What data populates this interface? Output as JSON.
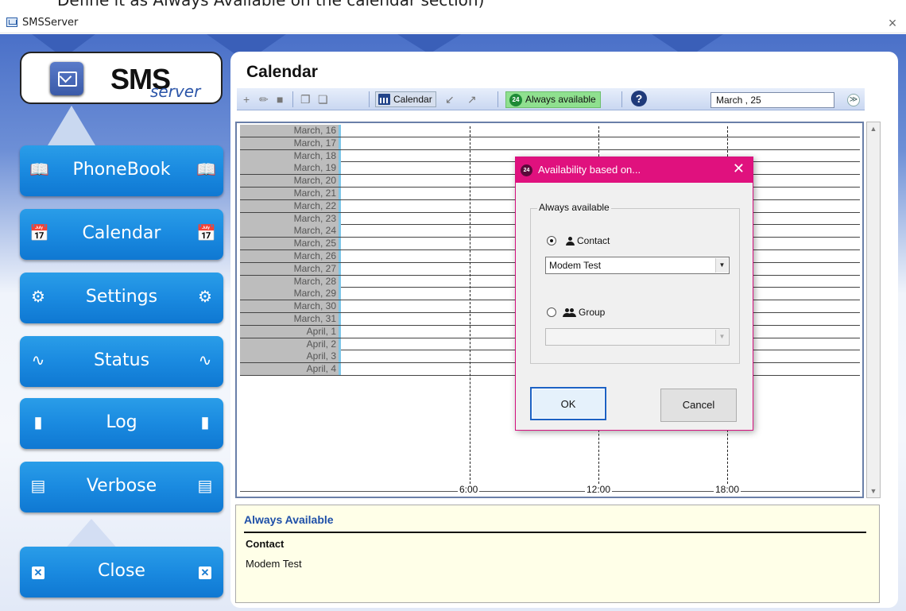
{
  "top_strip": {
    "text": "Define it as Always Available on the calendar section)"
  },
  "window": {
    "title": "SMSServer",
    "close_glyph": "×"
  },
  "logo": {
    "sms": "SMS",
    "server": "server"
  },
  "nav": [
    {
      "label": "PhoneBook",
      "icon": "book-icon"
    },
    {
      "label": "Calendar",
      "icon": "calendar-clock-icon"
    },
    {
      "label": "Settings",
      "icon": "gears-icon"
    },
    {
      "label": "Status",
      "icon": "pulse-icon"
    },
    {
      "label": "Log",
      "icon": "chat-icon"
    },
    {
      "label": "Verbose",
      "icon": "cards-icon"
    },
    {
      "label": "Close",
      "icon": "close-box-icon"
    }
  ],
  "calendar": {
    "title": "Calendar",
    "toolbar": {
      "calendar_label": "Calendar",
      "always_available_label": "Always available",
      "date_value": "March , 25",
      "help_glyph": "?",
      "expand_glyph": "≫"
    },
    "rows": [
      "March, 16",
      "March, 17",
      "March, 18",
      "March, 19",
      "March, 20",
      "March, 21",
      "March, 22",
      "March, 23",
      "March, 24",
      "March, 25",
      "March, 26",
      "March, 27",
      "March, 28",
      "March, 29",
      "March, 30",
      "March, 31",
      "April, 1",
      "April, 2",
      "April, 3",
      "April, 4"
    ],
    "axis": [
      "6:00",
      "12:00",
      "18:00"
    ]
  },
  "details": {
    "heading": "Always Available",
    "key": "Contact",
    "value": "Modem Test"
  },
  "dialog": {
    "title": "Availability based on...",
    "icon_text": "24",
    "close_glyph": "✕",
    "group_legend": "Always available",
    "contact_label": "Contact",
    "contact_selected": true,
    "contact_value": "Modem Test",
    "group_label": "Group",
    "group_selected": false,
    "group_value": "",
    "ok": "OK",
    "cancel": "Cancel"
  },
  "colors": {
    "accent": "#e0117e",
    "nav_blue": "#1a8ae0",
    "available_green": "#8fe08f",
    "details_bg": "#ffffe8"
  }
}
